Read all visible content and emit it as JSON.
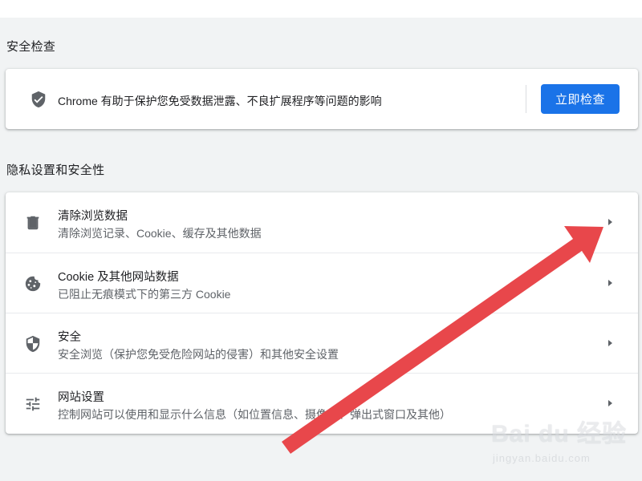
{
  "safety_check": {
    "section_title": "安全检查",
    "description": "Chrome 有助于保护您免受数据泄露、不良扩展程序等问题的影响",
    "button_label": "立即检查",
    "icon": "shield-check-icon"
  },
  "privacy": {
    "section_title": "隐私设置和安全性",
    "items": [
      {
        "title": "清除浏览数据",
        "subtitle": "清除浏览记录、Cookie、缓存及其他数据",
        "icon": "trash-icon"
      },
      {
        "title": "Cookie 及其他网站数据",
        "subtitle": "已阻止无痕模式下的第三方 Cookie",
        "icon": "cookie-icon"
      },
      {
        "title": "安全",
        "subtitle": "安全浏览（保护您免受危险网站的侵害）和其他安全设置",
        "icon": "shield-half-icon"
      },
      {
        "title": "网站设置",
        "subtitle": "控制网站可以使用和显示什么信息（如位置信息、摄像头、弹出式窗口及其他）",
        "icon": "sliders-icon"
      }
    ]
  },
  "watermark": {
    "brand": "Bai du 经验",
    "url": "jingyan.baidu.com"
  },
  "colors": {
    "accent": "#1a73e8",
    "annotation_arrow": "#e8474b",
    "background": "#f1f3f4"
  }
}
